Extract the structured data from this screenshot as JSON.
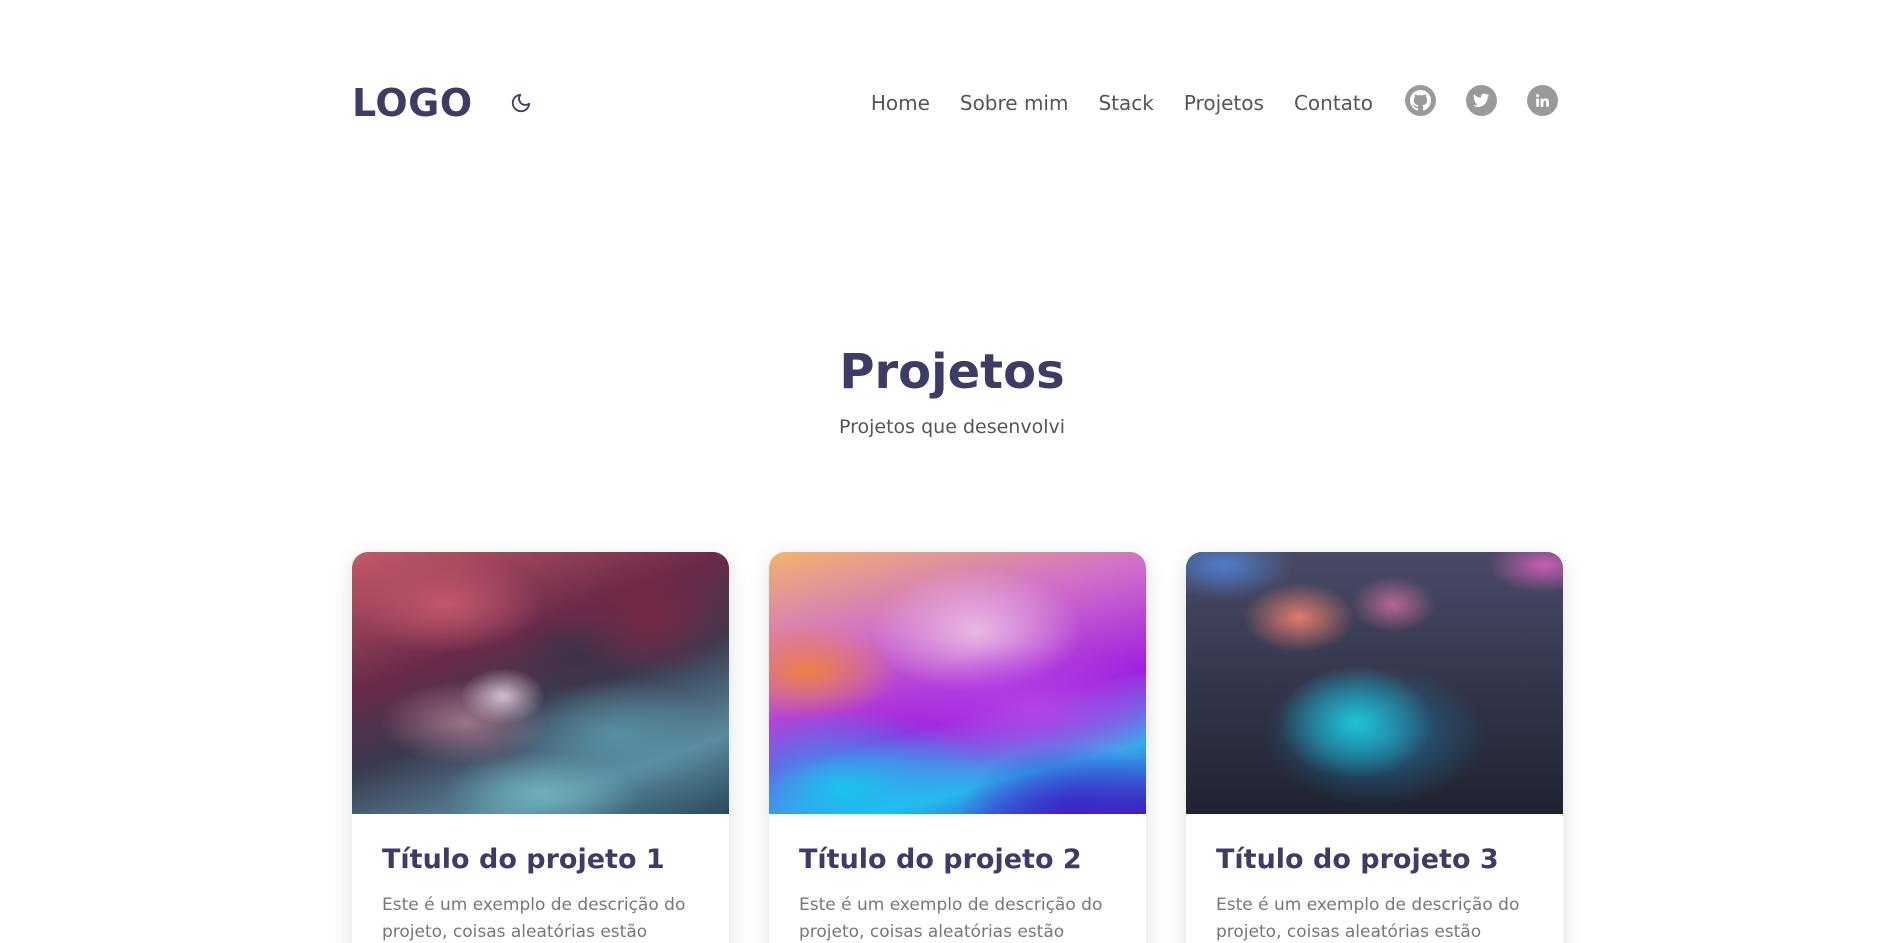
{
  "header": {
    "logo": "LOGO",
    "theme_toggle_icon": "moon-icon",
    "nav": [
      {
        "label": "Home"
      },
      {
        "label": "Sobre mim"
      },
      {
        "label": "Stack"
      },
      {
        "label": "Projetos"
      },
      {
        "label": "Contato"
      }
    ],
    "socials": [
      {
        "icon": "github-icon"
      },
      {
        "icon": "twitter-icon"
      },
      {
        "icon": "linkedin-icon"
      }
    ]
  },
  "colors": {
    "primary": "#3d3c66",
    "text": "#555555",
    "muted": "#777777",
    "social_icon": "#9a9a9a",
    "background": "#ffffff"
  },
  "projects_section": {
    "title": "Projetos",
    "subtitle": "Projetos que desenvolvi"
  },
  "projects": [
    {
      "title": "Título do projeto 1",
      "description": "Este é um exemplo de descrição do projeto, coisas aleatórias estão"
    },
    {
      "title": "Título do projeto 2",
      "description": "Este é um exemplo de descrição do projeto, coisas aleatórias estão"
    },
    {
      "title": "Título do projeto 3",
      "description": "Este é um exemplo de descrição do projeto, coisas aleatórias estão"
    }
  ]
}
